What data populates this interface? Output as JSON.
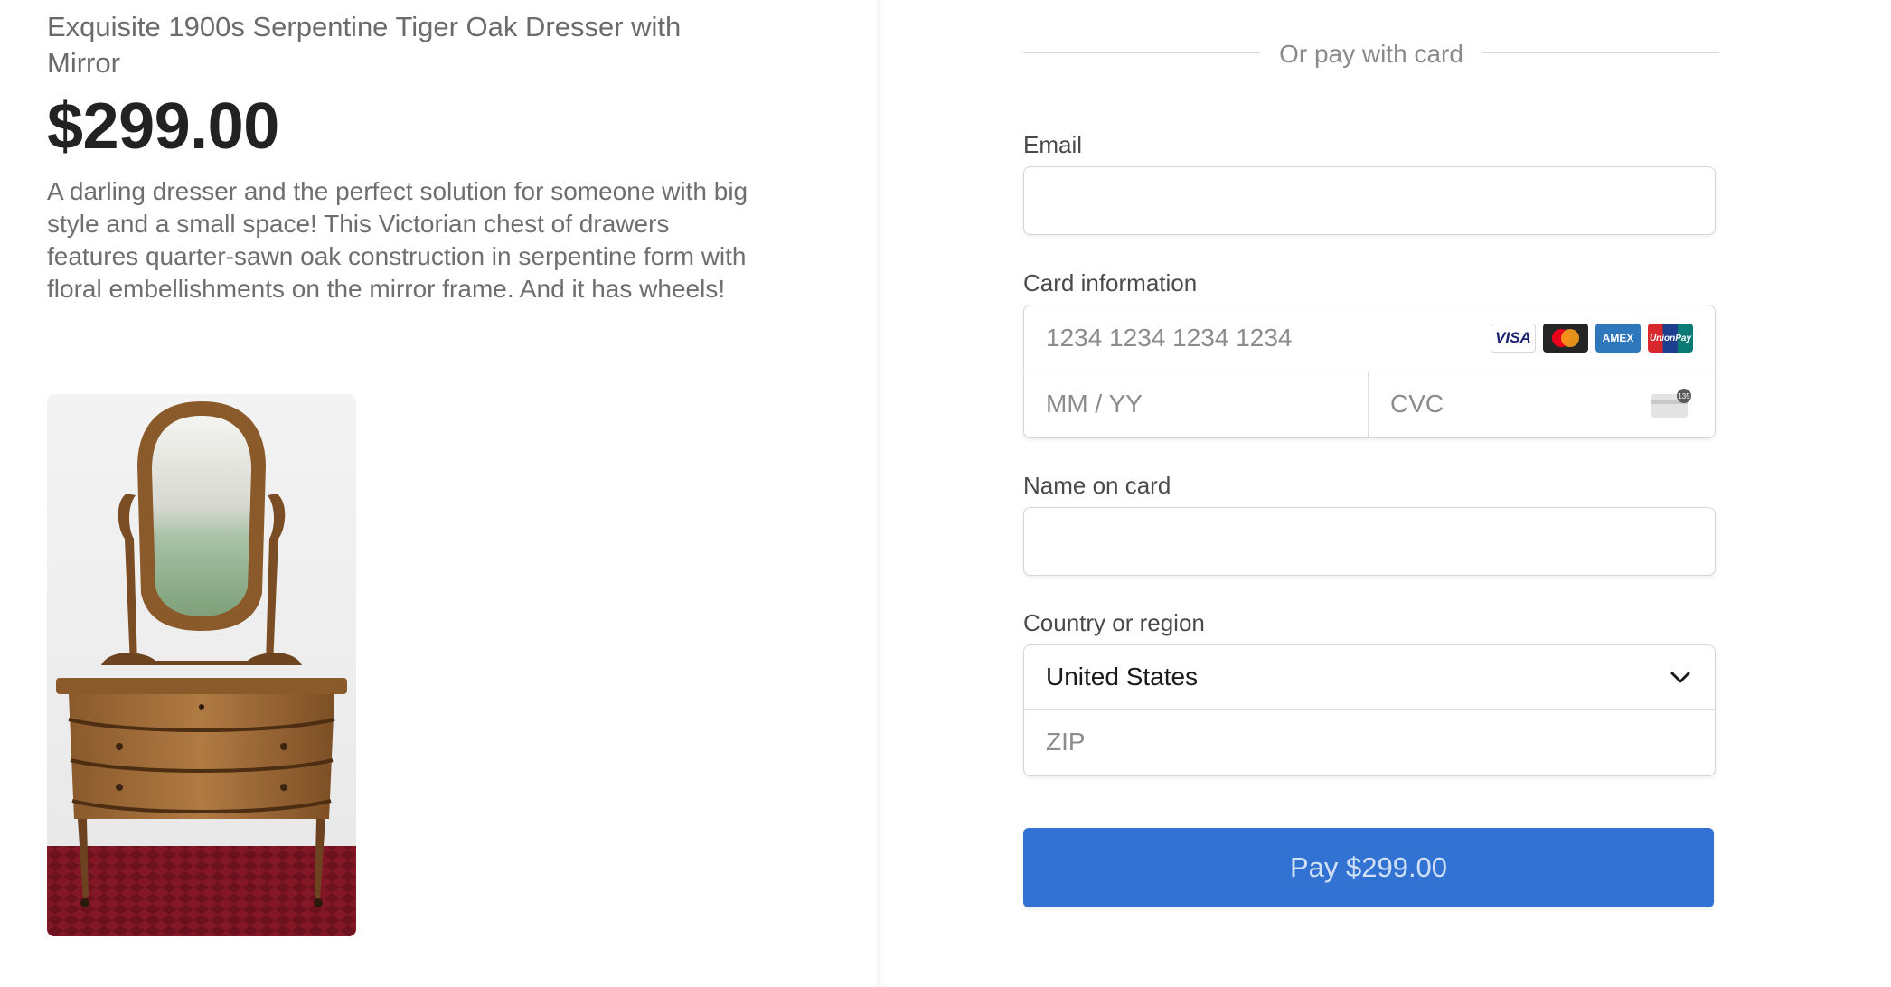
{
  "product": {
    "title": "Exquisite 1900s Serpentine Tiger Oak Dresser with Mirror",
    "price": "$299.00",
    "description": "A darling dresser and the perfect solution for someone with big style and a small space! This Victorian chest of drawers features quarter-sawn oak construction in serpentine form with floral embellishments on the mirror frame. And it has wheels!",
    "image_icon": "dresser-photo"
  },
  "form": {
    "divider_text": "Or pay with card",
    "email": {
      "label": "Email",
      "value": "",
      "placeholder": ""
    },
    "card": {
      "label": "Card information",
      "number_placeholder": "1234 1234 1234 1234",
      "expiry_placeholder": "MM / YY",
      "cvc_placeholder": "CVC",
      "brands": [
        "VISA",
        "mastercard",
        "AMEX",
        "UnionPay"
      ],
      "cvc_icon": "cvc-card-icon",
      "cvc_icon_text": "135"
    },
    "name": {
      "label": "Name on card",
      "value": "",
      "placeholder": ""
    },
    "country": {
      "label": "Country or region",
      "selected": "United States",
      "zip_placeholder": "ZIP"
    },
    "pay_button": "Pay $299.00"
  },
  "colors": {
    "accent": "#3272d2",
    "button_text": "#cfe0f7",
    "muted_text": "#6b6b6b"
  }
}
